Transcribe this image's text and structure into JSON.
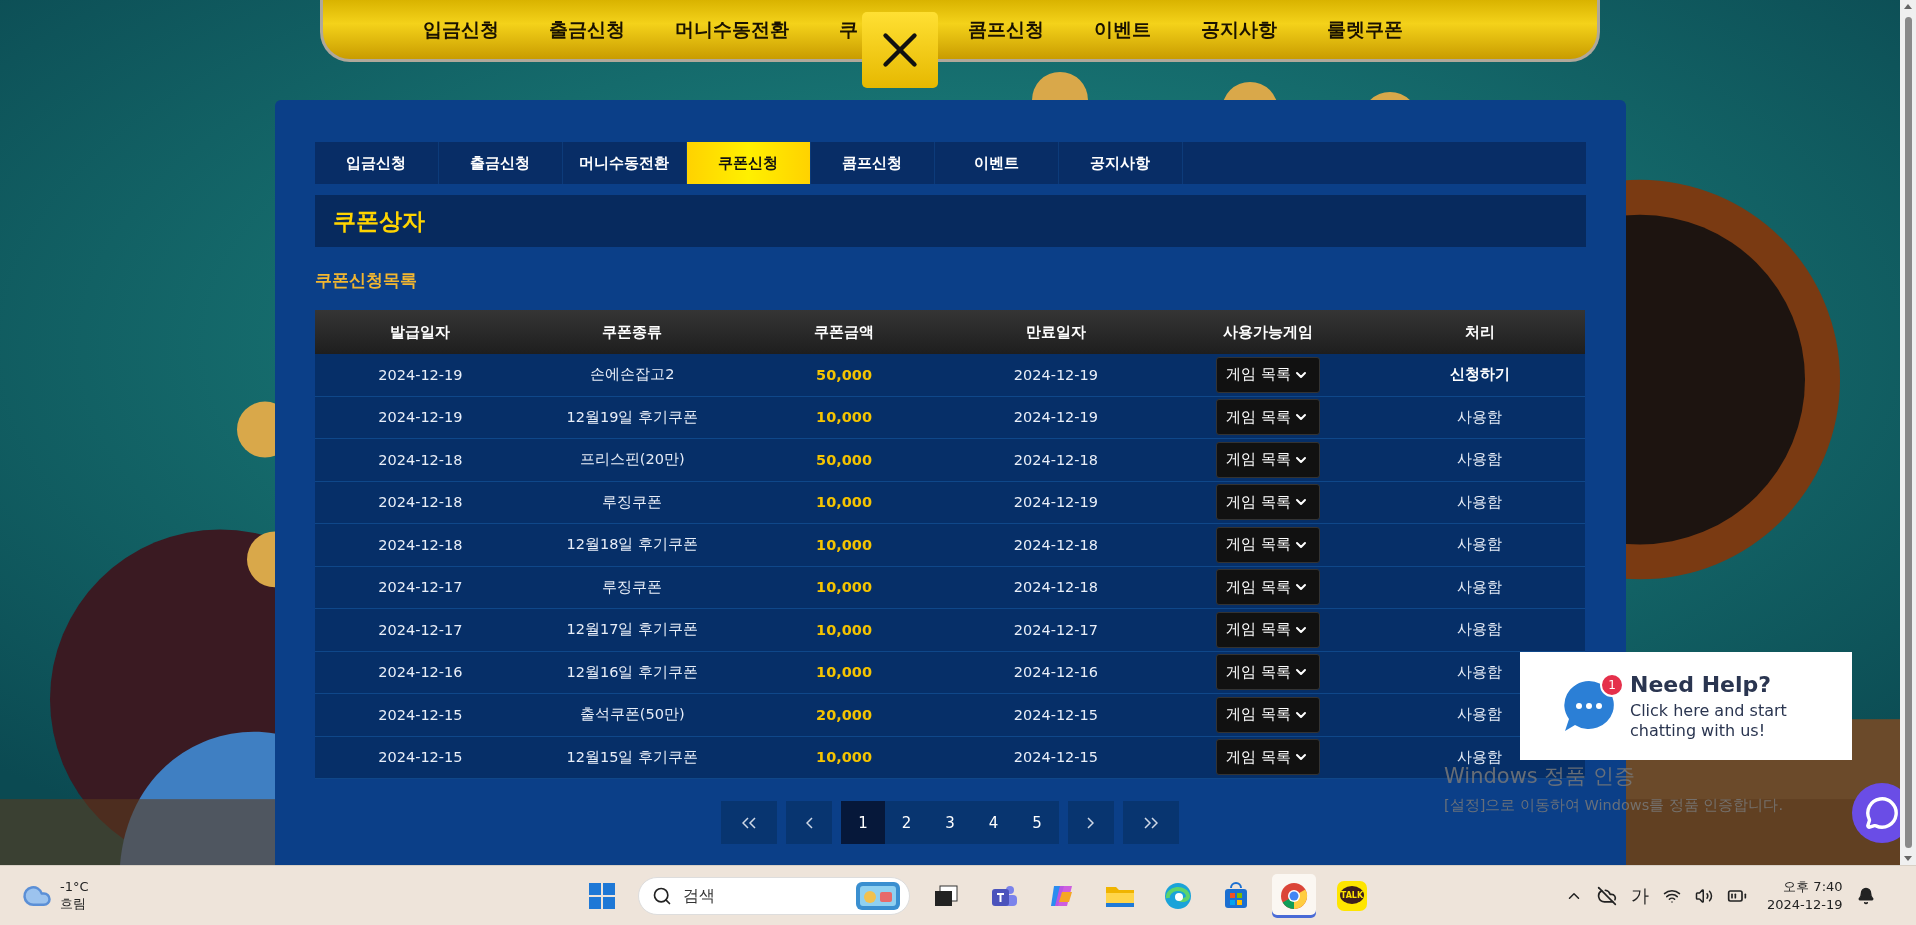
{
  "top_nav": {
    "items": [
      {
        "label": "입금신청"
      },
      {
        "label": "출금신청"
      },
      {
        "label": "머니수동전환"
      },
      {
        "label": "쿠"
      },
      {
        "label": "콤프신청"
      },
      {
        "label": "이벤트"
      },
      {
        "label": "공지사항"
      },
      {
        "label": "룰렛쿠폰"
      }
    ]
  },
  "tabs": [
    {
      "label": "입금신청",
      "selected": false
    },
    {
      "label": "출금신청",
      "selected": false
    },
    {
      "label": "머니수동전환",
      "selected": false
    },
    {
      "label": "쿠폰신청",
      "selected": true
    },
    {
      "label": "콤프신청",
      "selected": false
    },
    {
      "label": "이벤트",
      "selected": false
    },
    {
      "label": "공지사항",
      "selected": false
    }
  ],
  "section_title": "쿠폰상자",
  "list_title": "쿠폰신청목록",
  "table": {
    "columns": [
      "발급일자",
      "쿠폰종류",
      "쿠폰금액",
      "만료일자",
      "사용가능게임",
      "처리"
    ],
    "rows": [
      {
        "issued": "2024-12-19",
        "type": "손에손잡고2",
        "amount": "50,000",
        "expires": "2024-12-19",
        "game": "게임 목록",
        "action": {
          "kind": "apply",
          "label": "신청하기"
        }
      },
      {
        "issued": "2024-12-19",
        "type": "12월19일 후기쿠폰",
        "amount": "10,000",
        "expires": "2024-12-19",
        "game": "게임 목록",
        "action": {
          "kind": "used",
          "label": "사용함"
        }
      },
      {
        "issued": "2024-12-18",
        "type": "프리스핀(20만)",
        "amount": "50,000",
        "expires": "2024-12-18",
        "game": "게임 목록",
        "action": {
          "kind": "used",
          "label": "사용함"
        }
      },
      {
        "issued": "2024-12-18",
        "type": "루징쿠폰",
        "amount": "10,000",
        "expires": "2024-12-19",
        "game": "게임 목록",
        "action": {
          "kind": "used",
          "label": "사용함"
        }
      },
      {
        "issued": "2024-12-18",
        "type": "12월18일 후기쿠폰",
        "amount": "10,000",
        "expires": "2024-12-18",
        "game": "게임 목록",
        "action": {
          "kind": "used",
          "label": "사용함"
        }
      },
      {
        "issued": "2024-12-17",
        "type": "루징쿠폰",
        "amount": "10,000",
        "expires": "2024-12-18",
        "game": "게임 목록",
        "action": {
          "kind": "used",
          "label": "사용함"
        }
      },
      {
        "issued": "2024-12-17",
        "type": "12월17일 후기쿠폰",
        "amount": "10,000",
        "expires": "2024-12-17",
        "game": "게임 목록",
        "action": {
          "kind": "used",
          "label": "사용함"
        }
      },
      {
        "issued": "2024-12-16",
        "type": "12월16일 후기쿠폰",
        "amount": "10,000",
        "expires": "2024-12-16",
        "game": "게임 목록",
        "action": {
          "kind": "used",
          "label": "사용함"
        }
      },
      {
        "issued": "2024-12-15",
        "type": "출석쿠폰(50만)",
        "amount": "20,000",
        "expires": "2024-12-15",
        "game": "게임 목록",
        "action": {
          "kind": "used",
          "label": "사용함"
        }
      },
      {
        "issued": "2024-12-15",
        "type": "12월15일 후기쿠폰",
        "amount": "10,000",
        "expires": "2024-12-15",
        "game": "게임 목록",
        "action": {
          "kind": "used",
          "label": "사용함"
        }
      }
    ]
  },
  "pagination": {
    "pages": [
      {
        "label": "1",
        "selected": true
      },
      {
        "label": "2",
        "selected": false
      },
      {
        "label": "3",
        "selected": false
      },
      {
        "label": "4",
        "selected": false
      },
      {
        "label": "5",
        "selected": false
      }
    ]
  },
  "help_widget": {
    "title": "Need Help?",
    "text": "Click here and start chatting with us!",
    "badge": "1"
  },
  "activation_notice": {
    "title": "Windows 정품 인증",
    "text": "[설정]으로 이동하여 Windows를 정품 인증합니다."
  },
  "taskbar": {
    "weather": {
      "temp": "-1°C",
      "condition": "흐림"
    },
    "search": {
      "placeholder": "검색"
    },
    "apps": [
      {
        "kind": "task-view",
        "selected": false
      },
      {
        "kind": "teams",
        "selected": false
      },
      {
        "kind": "copilot",
        "selected": false
      },
      {
        "kind": "folder",
        "selected": false
      },
      {
        "kind": "edge",
        "selected": false
      },
      {
        "kind": "store",
        "selected": false
      },
      {
        "kind": "chrome",
        "selected": true
      },
      {
        "kind": "kakao",
        "label": "TALK",
        "selected": false
      }
    ],
    "ime": "가",
    "time": "오후 7:40",
    "date": "2024-12-19"
  }
}
